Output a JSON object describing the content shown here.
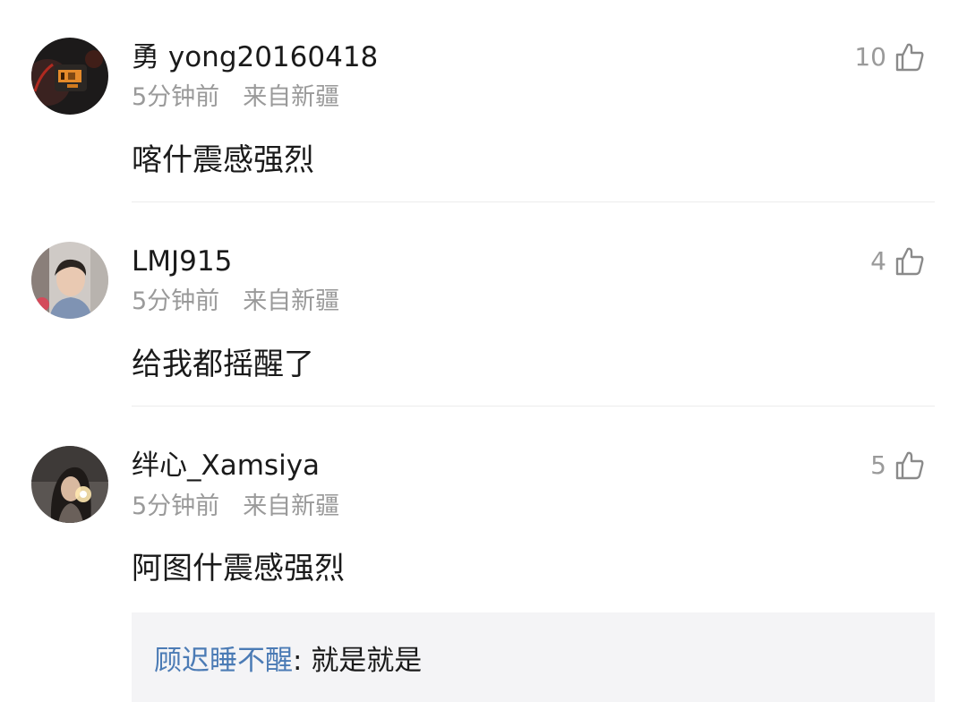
{
  "comments": [
    {
      "username": "勇 yong20160418",
      "time": "5分钟前",
      "location": "来自新疆",
      "text": "喀什震感强烈",
      "likes": "10",
      "avatar": "dashboard-avatar"
    },
    {
      "username": "LMJ915",
      "time": "5分钟前",
      "location": "来自新疆",
      "text": "给我都摇醒了",
      "likes": "4",
      "avatar": "young-man-avatar"
    },
    {
      "username": "绊心_Xamsiya",
      "time": "5分钟前",
      "location": "来自新疆",
      "text": "阿图什震感强烈",
      "likes": "5",
      "avatar": "sparkler-girl-avatar"
    }
  ],
  "reply": {
    "user": "顾迟睡不醒",
    "separator": ": ",
    "text": "就是就是"
  },
  "icons": {
    "like": "thumbs-up-outline-icon"
  },
  "colors": {
    "username": "#1a1a1a",
    "meta": "#9a9a9a",
    "reply_user": "#4b7bb5",
    "reply_bg": "#f4f4f6"
  }
}
